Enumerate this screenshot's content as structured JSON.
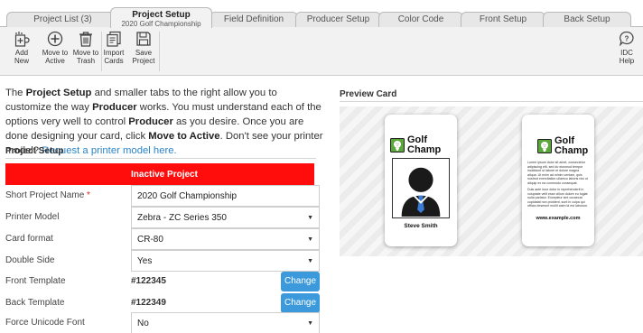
{
  "tabs": {
    "project_list": "Project List (3)",
    "project_setup": "Project Setup",
    "project_setup_sub": "2020 Golf Championship",
    "field_definition": "Field Definition",
    "producer_setup": "Producer Setup",
    "color_code": "Color Code",
    "front_setup": "Front Setup",
    "back_setup": "Back Setup"
  },
  "toolbar": {
    "add_new": [
      "Add",
      "New"
    ],
    "move_to_active": [
      "Move to",
      "Active"
    ],
    "move_to_trash": [
      "Move to",
      "Trash"
    ],
    "import_cards": [
      "Import",
      "Cards"
    ],
    "save_project": [
      "Save",
      "Project"
    ],
    "idc_help": [
      "IDC",
      "Help"
    ]
  },
  "intro": {
    "t1": "The ",
    "b1": "Project Setup",
    "t2": " and smaller tabs to the right allow you to customize the way ",
    "b2": "Producer",
    "t3": " works. You must understand each of the options very well to control ",
    "b3": "Producer",
    "t4": " as you desire. Once you are done designing your card, click ",
    "b4": "Move to Active",
    "t5": ". Don't see your printer model? ",
    "link": "Request a printer model here."
  },
  "section_title": "Project Setup",
  "status_banner": "Inactive Project",
  "form": {
    "short_name_label": "Short Project Name",
    "required_mark": "*",
    "short_name_value": "2020 Golf Championship",
    "printer_label": "Printer Model",
    "printer_value": "Zebra - ZC Series 350",
    "card_format_label": "Card format",
    "card_format_value": "CR-80",
    "double_side_label": "Double Side",
    "double_side_value": "Yes",
    "front_template_label": "Front Template",
    "front_template_value": "#122345",
    "back_template_label": "Back Template",
    "back_template_value": "#122349",
    "unicode_label": "Force Unicode Font",
    "unicode_value": "No",
    "change_label": "Change"
  },
  "preview": {
    "title": "Preview Card",
    "logo_line1": "Golf",
    "logo_line2": "Champ",
    "person_name": "Steve Smith",
    "back_text_1": "Lorem ipsum dolor sit amet, consectetur adipiscing elit, sed do eiusmod tempor incididunt ut labore et dolore magna aliqua. Ut enim ad minim veniam, quis nostrud exercitation ullamco laboris nisi ut aliquip ex ea commodo consequat.",
    "back_text_2": "Duis aute irure dolor in reprehenderit in voluptate velit esse cillum dolore eu fugiat nulla pariatur. Excepteur sint occaecat cupidatat non proident, sunt in culpa qui officia deserunt mollit anim id est laborum.",
    "website": "www.example.com"
  },
  "colors": {
    "banner_red": "#ff0d0d",
    "button_blue": "#3b99dc",
    "link_blue": "#2b84c8",
    "logo_green": "#5aa73a"
  },
  "icons": {
    "add_new": "add-icon",
    "move_to_active": "plus-circle-icon",
    "move_to_trash": "trash-icon",
    "import_cards": "import-cards-icon",
    "save_project": "save-icon",
    "idc_help": "help-icon",
    "dropdown": "chevron-down-icon"
  }
}
